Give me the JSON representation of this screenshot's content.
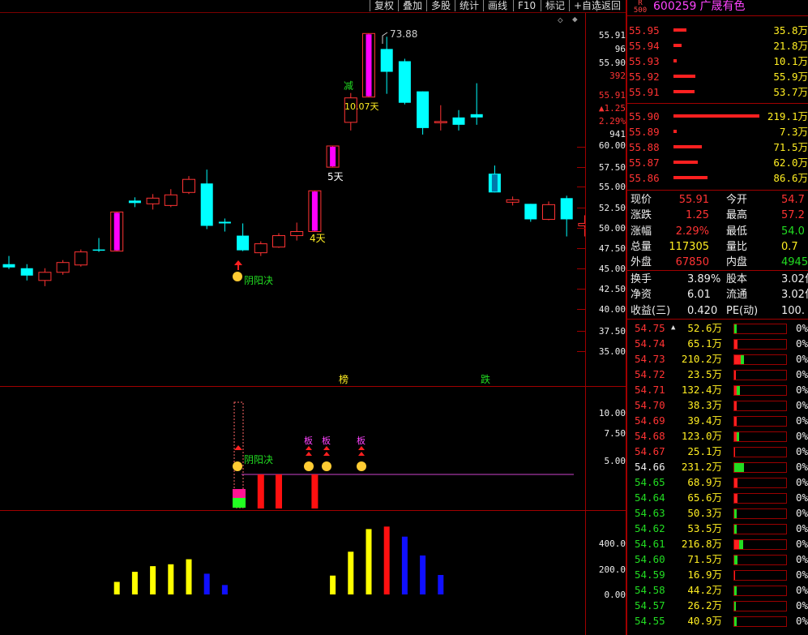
{
  "toolbar": {
    "buttons": [
      "复权",
      "叠加",
      "多股",
      "统计",
      "画线",
      "F10",
      "标记",
      "+自选",
      "返回"
    ]
  },
  "stock": {
    "badge_top": "R",
    "badge_bottom": "500",
    "code": "600259",
    "name": "广晟有色"
  },
  "colors": {
    "up": "#ff3333",
    "down": "#00ffff",
    "limit": "#ff00ff",
    "grid": "#a00000",
    "text_green": "#22dd22",
    "text_yellow": "#ffee22"
  },
  "main_axis": {
    "price_labels": [
      "55.91",
      "55.90",
      "60.00",
      "57.50",
      "55.00",
      "52.50",
      "50.00",
      "47.50",
      "45.00",
      "42.50",
      "40.00",
      "37.50",
      "35.00"
    ],
    "extra_labels": [
      {
        "text": "96",
        "cls": "white"
      },
      {
        "text": "392",
        "cls": "red"
      },
      {
        "text": "55.91",
        "cls": "red"
      },
      {
        "text": "▲1.25",
        "cls": "red"
      },
      {
        "text": "2.29%",
        "cls": "red"
      },
      {
        "text": "941",
        "cls": "white"
      }
    ]
  },
  "chart_data": {
    "type": "candlestick",
    "candles": [
      {
        "o": 45.6,
        "h": 46.6,
        "l": 45.0,
        "c": 45.2,
        "s": "down"
      },
      {
        "o": 45.1,
        "h": 45.6,
        "l": 43.6,
        "c": 44.2,
        "s": "down"
      },
      {
        "o": 43.6,
        "h": 45.1,
        "l": 42.9,
        "c": 44.6,
        "s": "up"
      },
      {
        "o": 44.6,
        "h": 46.1,
        "l": 44.3,
        "c": 45.8,
        "s": "up"
      },
      {
        "o": 45.5,
        "h": 47.4,
        "l": 45.3,
        "c": 47.1,
        "s": "up"
      },
      {
        "o": 47.3,
        "h": 48.8,
        "l": 47.1,
        "c": 47.4,
        "s": "cross"
      },
      {
        "o": 47.2,
        "h": 52.0,
        "l": 47.2,
        "c": 52.0,
        "s": "limit"
      },
      {
        "o": 53.4,
        "h": 53.8,
        "l": 52.6,
        "c": 53.1,
        "s": "down"
      },
      {
        "o": 53.0,
        "h": 54.2,
        "l": 52.3,
        "c": 53.7,
        "s": "up"
      },
      {
        "o": 52.8,
        "h": 54.8,
        "l": 52.6,
        "c": 54.1,
        "s": "up"
      },
      {
        "o": 54.4,
        "h": 56.4,
        "l": 54.2,
        "c": 56.0,
        "s": "up"
      },
      {
        "o": 55.5,
        "h": 57.2,
        "l": 49.9,
        "c": 50.3,
        "s": "down"
      },
      {
        "o": 50.8,
        "h": 51.2,
        "l": 49.6,
        "c": 50.6,
        "s": "down"
      },
      {
        "o": 49.1,
        "h": 50.6,
        "l": 47.2,
        "c": 47.3,
        "s": "down"
      },
      {
        "o": 47.0,
        "h": 48.4,
        "l": 46.6,
        "c": 48.1,
        "s": "up"
      },
      {
        "o": 47.7,
        "h": 49.4,
        "l": 47.6,
        "c": 49.1,
        "s": "up"
      },
      {
        "o": 49.1,
        "h": 50.7,
        "l": 48.5,
        "c": 49.6,
        "s": "up"
      },
      {
        "o": 49.6,
        "h": 54.6,
        "l": 49.6,
        "c": 54.6,
        "s": "limit"
      },
      {
        "o": 57.5,
        "h": 60.1,
        "l": 57.5,
        "c": 60.1,
        "s": "limit"
      },
      {
        "o": 63.0,
        "h": 66.6,
        "l": 62.0,
        "c": 66.0,
        "s": "up"
      },
      {
        "o": 66.1,
        "h": 73.9,
        "l": 66.1,
        "c": 73.9,
        "s": "limit"
      },
      {
        "o": 72.0,
        "h": 73.5,
        "l": 66.5,
        "c": 69.2,
        "s": "down"
      },
      {
        "o": 70.5,
        "h": 70.8,
        "l": 65.2,
        "c": 65.4,
        "s": "down"
      },
      {
        "o": 66.8,
        "h": 66.8,
        "l": 61.5,
        "c": 62.3,
        "s": "down"
      },
      {
        "o": 63.0,
        "h": 65.1,
        "l": 62.0,
        "c": 63.1,
        "s": "up"
      },
      {
        "o": 63.6,
        "h": 64.5,
        "l": 62.0,
        "c": 62.7,
        "s": "down"
      },
      {
        "o": 64.0,
        "h": 67.8,
        "l": 62.7,
        "c": 63.6,
        "s": "down"
      },
      {
        "o": 56.7,
        "h": 57.7,
        "l": 54.4,
        "c": 54.4,
        "s": "limitdown"
      },
      {
        "o": 53.2,
        "h": 53.9,
        "l": 52.8,
        "c": 53.5,
        "s": "up"
      },
      {
        "o": 53.0,
        "h": 53.0,
        "l": 50.8,
        "c": 51.1,
        "s": "down"
      },
      {
        "o": 51.1,
        "h": 53.3,
        "l": 51.0,
        "c": 52.9,
        "s": "up"
      },
      {
        "o": 53.7,
        "h": 54.0,
        "l": 49.0,
        "c": 51.1,
        "s": "down"
      },
      {
        "o": 50.6,
        "h": 51.6,
        "l": 49.0,
        "c": 50.3,
        "s": "up"
      }
    ],
    "annotations": [
      {
        "text": "73.88",
        "type": "high"
      },
      {
        "text": "减",
        "cls": "green"
      },
      {
        "text": "10.07天",
        "cls": "yellow"
      },
      {
        "text": "5天",
        "cls": "white"
      },
      {
        "text": "4天",
        "cls": "yellow"
      },
      {
        "text": "阴阳决",
        "cls": "green"
      },
      {
        "text": "榜",
        "cls": "yellow"
      },
      {
        "text": "跌",
        "cls": "green"
      }
    ],
    "sub1": {
      "axis": [
        "10.00",
        "7.50",
        "5.00"
      ],
      "signal_label": "阴阳决",
      "bars": [
        {
          "i": 14,
          "h": 1
        },
        {
          "i": 15,
          "h": 1
        },
        {
          "i": 17,
          "h": 1
        }
      ],
      "board_labels": [
        "板",
        "板",
        "板"
      ]
    },
    "sub2": {
      "axis": [
        "400.0",
        "200.0",
        "0.00"
      ],
      "bars": [
        {
          "i": 6,
          "v": 100,
          "c": "yellow"
        },
        {
          "i": 7,
          "v": 180,
          "c": "yellow"
        },
        {
          "i": 8,
          "v": 225,
          "c": "yellow"
        },
        {
          "i": 9,
          "v": 240,
          "c": "yellow"
        },
        {
          "i": 10,
          "v": 280,
          "c": "yellow"
        },
        {
          "i": 11,
          "v": 165,
          "c": "blue"
        },
        {
          "i": 12,
          "v": 75,
          "c": "blue"
        },
        {
          "i": 18,
          "v": 150,
          "c": "yellow"
        },
        {
          "i": 19,
          "v": 340,
          "c": "yellow"
        },
        {
          "i": 20,
          "v": 520,
          "c": "yellow"
        },
        {
          "i": 21,
          "v": 540,
          "c": "red"
        },
        {
          "i": 22,
          "v": 460,
          "c": "blue"
        },
        {
          "i": 23,
          "v": 310,
          "c": "blue"
        },
        {
          "i": 24,
          "v": 155,
          "c": "blue"
        }
      ]
    }
  },
  "orderbook": {
    "sell": [
      {
        "p": "55.95",
        "v": "35.8万",
        "w": 16
      },
      {
        "p": "55.94",
        "v": "21.8万",
        "w": 10
      },
      {
        "p": "55.93",
        "v": "10.1万",
        "w": 4
      },
      {
        "p": "55.92",
        "v": "55.9万",
        "w": 27
      },
      {
        "p": "55.91",
        "v": "53.7万",
        "w": 26
      }
    ],
    "buy": [
      {
        "p": "55.90",
        "v": "219.1万",
        "w": 106
      },
      {
        "p": "55.89",
        "v": "7.3万",
        "w": 4
      },
      {
        "p": "55.88",
        "v": "71.5万",
        "w": 35
      },
      {
        "p": "55.87",
        "v": "62.0万",
        "w": 30
      },
      {
        "p": "55.86",
        "v": "86.6万",
        "w": 42
      }
    ]
  },
  "quote": [
    {
      "l1": "现价",
      "v1": "55.91",
      "c1": "red",
      "l2": "今开",
      "v2": "54.7",
      "c2": "red"
    },
    {
      "l1": "涨跌",
      "v1": "1.25",
      "c1": "red",
      "l2": "最高",
      "v2": "57.2",
      "c2": "red"
    },
    {
      "l1": "涨幅",
      "v1": "2.29%",
      "c1": "red",
      "l2": "最低",
      "v2": "54.0",
      "c2": "green"
    },
    {
      "l1": "总量",
      "v1": "117305",
      "c1": "yellow",
      "l2": "量比",
      "v2": "0.7",
      "c2": "yellow"
    },
    {
      "l1": "外盘",
      "v1": "67850",
      "c1": "red",
      "l2": "内盘",
      "v2": "4945",
      "c2": "green"
    },
    {
      "l1": "换手",
      "v1": "3.89%",
      "c1": "white",
      "l2": "股本",
      "v2": "3.02亿",
      "c2": "white"
    },
    {
      "l1": "净资",
      "v1": "6.01",
      "c1": "white",
      "l2": "流通",
      "v2": "3.02亿",
      "c2": "white"
    },
    {
      "l1": "收益(三)",
      "v1": "0.420",
      "c1": "white",
      "l2": "PE(动)",
      "v2": "100.",
      "c2": "white"
    }
  ],
  "trades": [
    {
      "p": "54.75",
      "v": "52.6万",
      "c": "red",
      "r": 0,
      "g": 3,
      "pct": "0%",
      "mark": "▲"
    },
    {
      "p": "54.74",
      "v": "65.1万",
      "c": "red",
      "r": 4,
      "g": 0,
      "pct": "0%"
    },
    {
      "p": "54.73",
      "v": "210.2万",
      "c": "red",
      "r": 8,
      "g": 4,
      "pct": "0%"
    },
    {
      "p": "54.72",
      "v": "23.5万",
      "c": "red",
      "r": 2,
      "g": 0,
      "pct": "0%"
    },
    {
      "p": "54.71",
      "v": "132.4万",
      "c": "red",
      "r": 3,
      "g": 4,
      "pct": "0%"
    },
    {
      "p": "54.70",
      "v": "38.3万",
      "c": "red",
      "r": 3,
      "g": 0,
      "pct": "0%"
    },
    {
      "p": "54.69",
      "v": "39.4万",
      "c": "red",
      "r": 3,
      "g": 0,
      "pct": "0%"
    },
    {
      "p": "54.68",
      "v": "123.0万",
      "c": "red",
      "r": 3,
      "g": 3,
      "pct": "0%"
    },
    {
      "p": "54.67",
      "v": "25.1万",
      "c": "red",
      "r": 1,
      "g": 0,
      "pct": "0%"
    },
    {
      "p": "54.66",
      "v": "231.2万",
      "c": "white",
      "r": 0,
      "g": 12,
      "pct": "0%"
    },
    {
      "p": "54.65",
      "v": "68.9万",
      "c": "green",
      "r": 4,
      "g": 0,
      "pct": "0%"
    },
    {
      "p": "54.64",
      "v": "65.6万",
      "c": "green",
      "r": 4,
      "g": 0,
      "pct": "0%"
    },
    {
      "p": "54.63",
      "v": "50.3万",
      "c": "green",
      "r": 0,
      "g": 3,
      "pct": "0%"
    },
    {
      "p": "54.62",
      "v": "53.5万",
      "c": "green",
      "r": 0,
      "g": 3,
      "pct": "0%"
    },
    {
      "p": "54.61",
      "v": "216.8万",
      "c": "green",
      "r": 6,
      "g": 5,
      "pct": "0%"
    },
    {
      "p": "54.60",
      "v": "71.5万",
      "c": "green",
      "r": 0,
      "g": 4,
      "pct": "0%"
    },
    {
      "p": "54.59",
      "v": "16.9万",
      "c": "green",
      "r": 1,
      "g": 0,
      "pct": "0%"
    },
    {
      "p": "54.58",
      "v": "44.2万",
      "c": "green",
      "r": 0,
      "g": 3,
      "pct": "0%"
    },
    {
      "p": "54.57",
      "v": "26.2万",
      "c": "green",
      "r": 0,
      "g": 2,
      "pct": "0%"
    },
    {
      "p": "54.55",
      "v": "40.9万",
      "c": "green",
      "r": 0,
      "g": 3,
      "pct": "0%"
    }
  ]
}
